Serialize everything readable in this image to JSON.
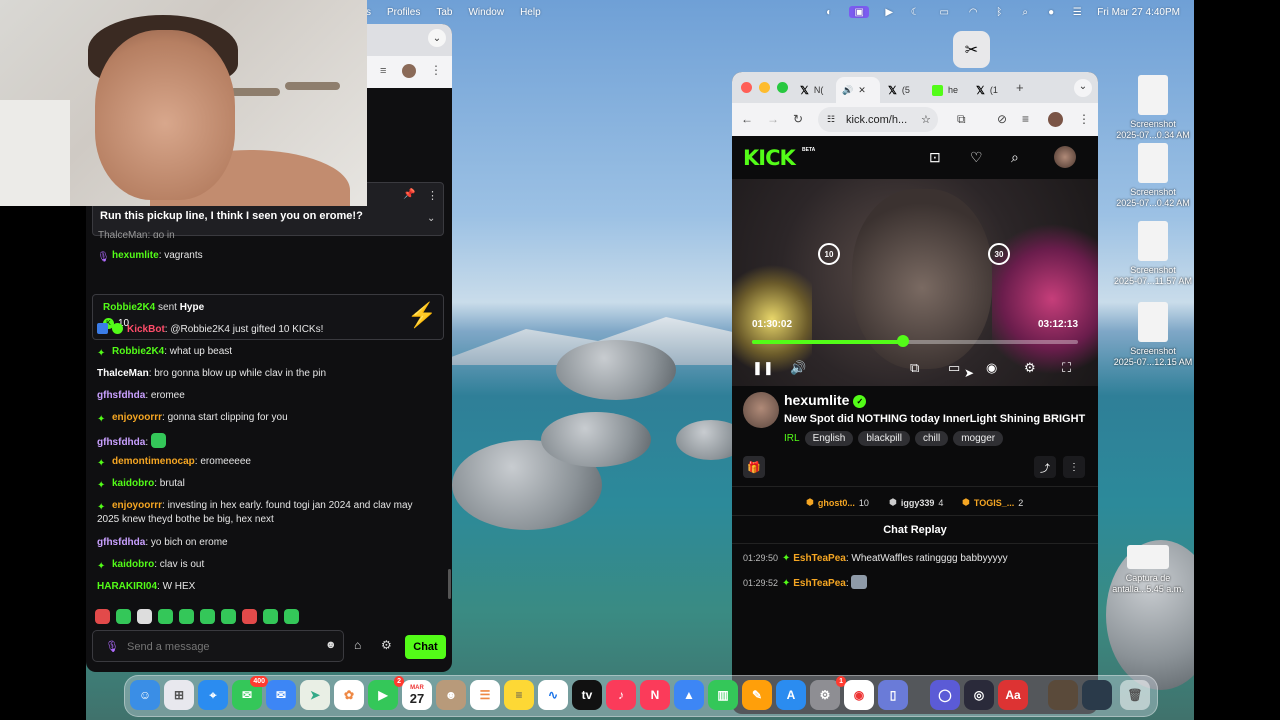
{
  "menubar": {
    "items": [
      "s",
      "Profiles",
      "Tab",
      "Window",
      "Help"
    ],
    "datetime": "Fri Mar 27  4:40PM"
  },
  "left_chat": {
    "pinned_text": "Run this pickup line, I think I seen you on erome!?",
    "cut_text": "ThalceMan: go in",
    "messages": [
      {
        "user": "hexumlite",
        "text": "vagrants",
        "color": "#53fc18",
        "badge": "mic"
      },
      {
        "user": "KickBot",
        "text": "@Robbie2K4 just gifted 10 KICKs!",
        "color": "#ff4d6a",
        "badge": "bot"
      },
      {
        "user": "Robbie2K4",
        "text": "what up beast",
        "color": "#53fc18",
        "badge": "sub"
      },
      {
        "user": "ThalceMan",
        "text": "bro gonna blow up while clav in the pin",
        "color": "#ffffff",
        "badge": ""
      },
      {
        "user": "gfhsfdhda",
        "text": "eromee",
        "color": "#c9a0ff",
        "badge": ""
      },
      {
        "user": "enjoyoorrr",
        "text": "gonna start clipping for you",
        "color": "#f5a623",
        "badge": "sub"
      },
      {
        "user": "gfhsfdhda",
        "text": "",
        "color": "#c9a0ff",
        "badge": "",
        "emote": true
      },
      {
        "user": "demontimenocap",
        "text": "eromeeeee",
        "color": "#f5a623",
        "badge": "sub"
      },
      {
        "user": "kaidobro",
        "text": "brutal",
        "color": "#53fc18",
        "badge": "sub"
      },
      {
        "user": "enjoyoorrr",
        "text": "investing in hex early. found togi jan 2024 and clav may 2025 knew theyd bothe be big, hex next",
        "color": "#f5a623",
        "badge": "sub"
      },
      {
        "user": "gfhsfdhda",
        "text": "yo bich on erome",
        "color": "#c9a0ff",
        "badge": ""
      },
      {
        "user": "kaidobro",
        "text": "clav is out",
        "color": "#53fc18",
        "badge": "sub"
      },
      {
        "user": "HARAKIRI04",
        "text": "W HEX",
        "color": "#53fc18",
        "badge": ""
      }
    ],
    "hype": {
      "user": "Robbie2K4",
      "action": "sent",
      "item": "Hype",
      "amount": "10"
    },
    "input_placeholder": "Send a message",
    "chat_button": "Chat"
  },
  "kick": {
    "tabs": [
      "N(",
      "(5",
      "he",
      "(1"
    ],
    "url": "kick.com/h...",
    "logo": "KICK",
    "beta": "BETA",
    "player": {
      "current": "01:30:02",
      "total": "03:12:13",
      "progress": 0.462,
      "skip_back": "10",
      "skip_fwd": "30"
    },
    "streamer": {
      "name": "hexumlite",
      "title": "New Spot did NOTHING today InnerLight Shining BRIGHT",
      "category": "IRL",
      "tags": [
        "English",
        "blackpill",
        "chill",
        "mogger"
      ]
    },
    "leaderboard": [
      {
        "name": "ghost0...",
        "count": "10"
      },
      {
        "name": "iggy339",
        "count": "4"
      },
      {
        "name": "TOGIS_...",
        "count": "2"
      }
    ],
    "chat_replay_title": "Chat Replay",
    "replay": [
      {
        "time": "01:29:50",
        "user": "EshTeaPea",
        "text": "WheatWaffles ratingggg babbyyyyy"
      },
      {
        "time": "01:29:52",
        "user": "EshTeaPea",
        "text": ""
      }
    ]
  },
  "desktop": {
    "icons": [
      {
        "l1": "Screenshot",
        "l2": "2025-07...0.34 AM"
      },
      {
        "l1": "Screenshot",
        "l2": "2025-07...0.42 AM"
      },
      {
        "l1": "Screenshot",
        "l2": "2025-07...11.57 AM"
      },
      {
        "l1": "Screenshot",
        "l2": "2025-07...12.15 AM"
      },
      {
        "l1": "Captura de",
        "l2": "antalla...5.45 a.m."
      }
    ]
  },
  "dock": {
    "calendar_month": "MAR",
    "calendar_day": "27",
    "badges": {
      "messages": "400",
      "facetime": "2",
      "settings": "1"
    }
  }
}
